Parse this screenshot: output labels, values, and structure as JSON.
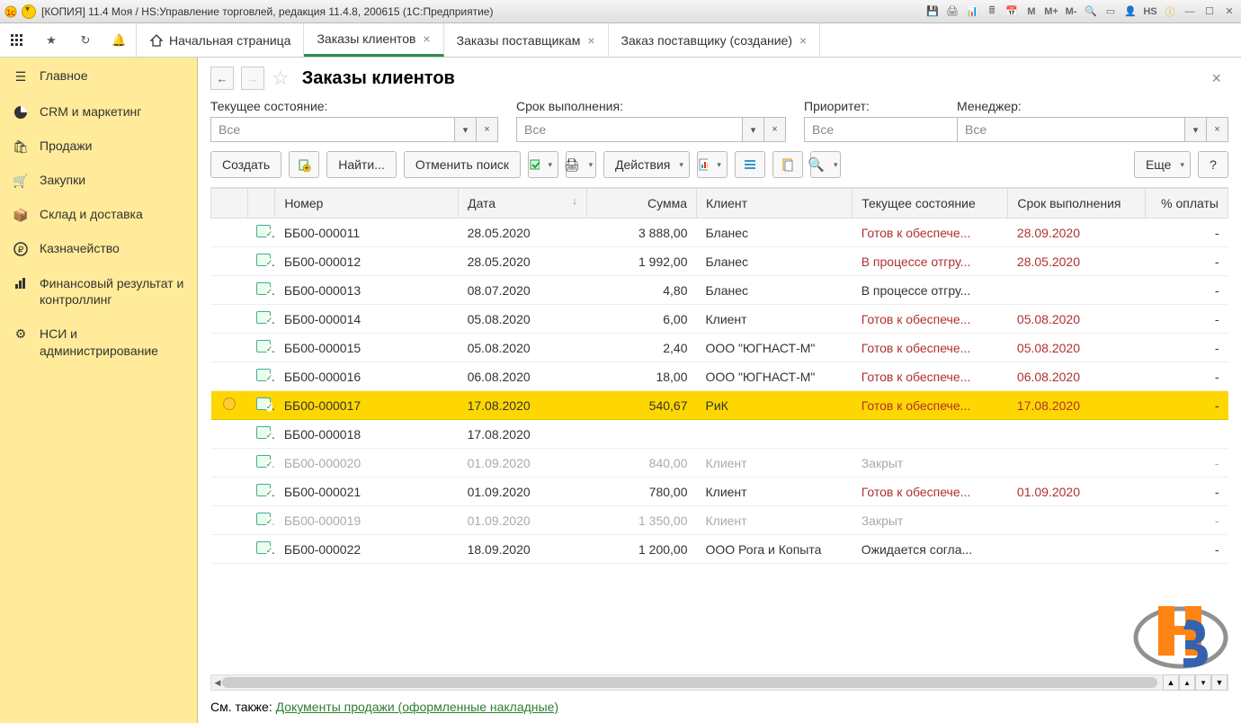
{
  "window": {
    "title": "[КОПИЯ] 11.4 Моя / HS:Управление торговлей, редакция 11.4.8, 200615  (1С:Предприятие)",
    "m": "M",
    "mplus": "M+",
    "mminus": "M-",
    "user": "HS"
  },
  "tabs": {
    "home": "Начальная страница",
    "t1": "Заказы клиентов",
    "t2": "Заказы поставщикам",
    "t3": "Заказ поставщику (создание)"
  },
  "sidebar": {
    "items": [
      {
        "label": "Главное"
      },
      {
        "label": "CRM и маркетинг"
      },
      {
        "label": "Продажи"
      },
      {
        "label": "Закупки"
      },
      {
        "label": "Склад и доставка"
      },
      {
        "label": "Казначейство"
      },
      {
        "label": "Финансовый результат и контроллинг"
      },
      {
        "label": "НСИ и администрирование"
      }
    ]
  },
  "page": {
    "title": "Заказы клиентов",
    "footer_prefix": "См. также: ",
    "footer_link": "Документы продажи (оформленные накладные)"
  },
  "filters": {
    "state_label": "Текущее состояние:",
    "due_label": "Срок выполнения:",
    "priority_label": "Приоритет:",
    "manager_label": "Менеджер:",
    "all": "Все"
  },
  "toolbar": {
    "create": "Создать",
    "find": "Найти...",
    "cancel_search": "Отменить поиск",
    "actions": "Действия",
    "more": "Еще",
    "help": "?"
  },
  "columns": {
    "number": "Номер",
    "date": "Дата",
    "sum": "Сумма",
    "client": "Клиент",
    "status": "Текущее состояние",
    "due": "Срок выполнения",
    "pay": "% оплаты"
  },
  "rows": [
    {
      "num": "ББ00-000011",
      "date": "28.05.2020",
      "sum": "3 888,00",
      "client": "Бланес",
      "status": "Готов к обеспече...",
      "status_cls": "status-red",
      "due": "28.09.2020",
      "due_cls": "date-red",
      "pay": "-",
      "dim": false,
      "sel": false,
      "ind": ""
    },
    {
      "num": "ББ00-000012",
      "date": "28.05.2020",
      "sum": "1 992,00",
      "client": "Бланес",
      "status": "В процессе отгру...",
      "status_cls": "status-red",
      "due": "28.05.2020",
      "due_cls": "date-red",
      "pay": "-",
      "dim": false,
      "sel": false,
      "ind": ""
    },
    {
      "num": "ББ00-000013",
      "date": "08.07.2020",
      "sum": "4,80",
      "client": "Бланес",
      "status": "В процессе отгру...",
      "status_cls": "",
      "due": "",
      "due_cls": "",
      "pay": "-",
      "dim": false,
      "sel": false,
      "ind": ""
    },
    {
      "num": "ББ00-000014",
      "date": "05.08.2020",
      "sum": "6,00",
      "client": "Клиент",
      "status": "Готов к обеспече...",
      "status_cls": "status-red",
      "due": "05.08.2020",
      "due_cls": "date-red",
      "pay": "-",
      "dim": false,
      "sel": false,
      "ind": ""
    },
    {
      "num": "ББ00-000015",
      "date": "05.08.2020",
      "sum": "2,40",
      "client": "ООО \"ЮГНАСТ-М\"",
      "status": "Готов к обеспече...",
      "status_cls": "status-red",
      "due": "05.08.2020",
      "due_cls": "date-red",
      "pay": "-",
      "dim": false,
      "sel": false,
      "ind": ""
    },
    {
      "num": "ББ00-000016",
      "date": "06.08.2020",
      "sum": "18,00",
      "client": "ООО \"ЮГНАСТ-М\"",
      "status": "Готов к обеспече...",
      "status_cls": "status-red",
      "due": "06.08.2020",
      "due_cls": "date-red",
      "pay": "-",
      "dim": false,
      "sel": false,
      "ind": ""
    },
    {
      "num": "ББ00-000017",
      "date": "17.08.2020",
      "sum": "540,67",
      "client": "РиК",
      "status": "Готов к обеспече...",
      "status_cls": "status-red",
      "due": "17.08.2020",
      "due_cls": "date-red",
      "pay": "-",
      "dim": false,
      "sel": true,
      "ind": "bulb"
    },
    {
      "num": "ББ00-000018",
      "date": "17.08.2020",
      "sum": "",
      "client": "",
      "status": "",
      "status_cls": "",
      "due": "",
      "due_cls": "",
      "pay": "",
      "dim": false,
      "sel": false,
      "ind": ""
    },
    {
      "num": "ББ00-000020",
      "date": "01.09.2020",
      "sum": "840,00",
      "client": "Клиент",
      "status": "Закрыт",
      "status_cls": "",
      "due": "",
      "due_cls": "",
      "pay": "-",
      "dim": true,
      "sel": false,
      "ind": ""
    },
    {
      "num": "ББ00-000021",
      "date": "01.09.2020",
      "sum": "780,00",
      "client": "Клиент",
      "status": "Готов к обеспече...",
      "status_cls": "status-red",
      "due": "01.09.2020",
      "due_cls": "date-red",
      "pay": "-",
      "dim": false,
      "sel": false,
      "ind": ""
    },
    {
      "num": "ББ00-000019",
      "date": "01.09.2020",
      "sum": "1 350,00",
      "client": "Клиент",
      "status": "Закрыт",
      "status_cls": "",
      "due": "",
      "due_cls": "",
      "pay": "-",
      "dim": true,
      "sel": false,
      "ind": ""
    },
    {
      "num": "ББ00-000022",
      "date": "18.09.2020",
      "sum": "1 200,00",
      "client": "ООО Рога и Копыта",
      "status": "Ожидается согла...",
      "status_cls": "",
      "due": "",
      "due_cls": "",
      "pay": "-",
      "dim": false,
      "sel": false,
      "ind": ""
    }
  ]
}
